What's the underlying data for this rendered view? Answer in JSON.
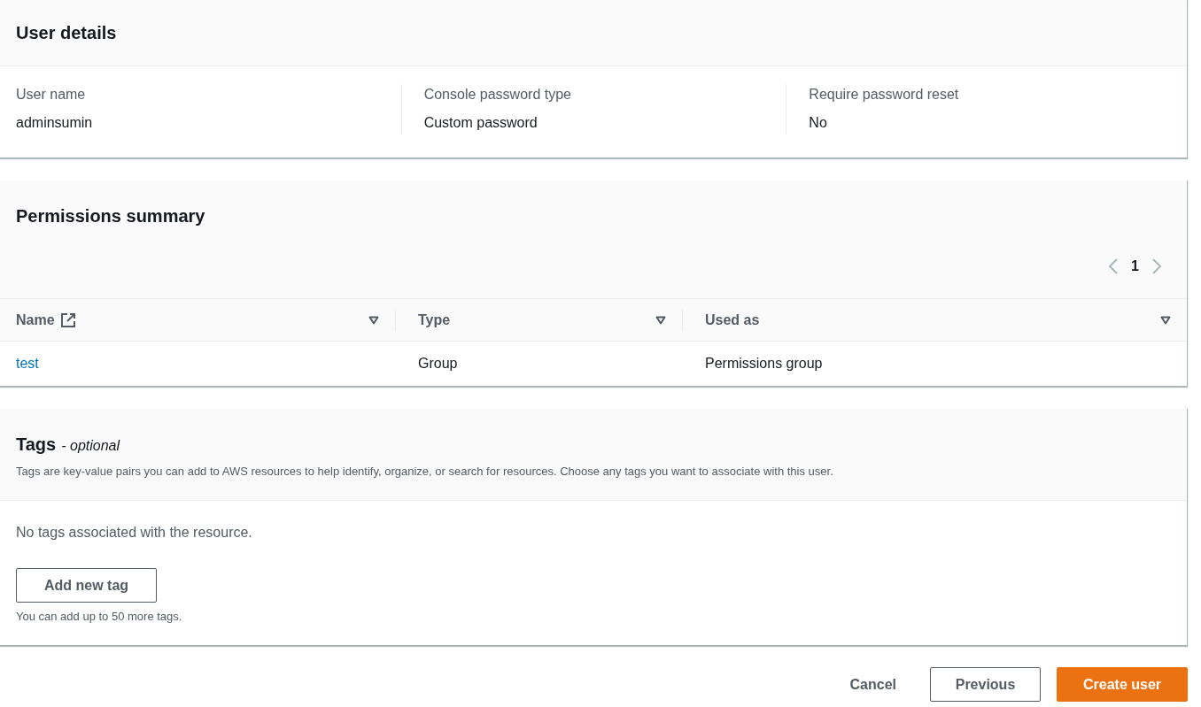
{
  "user_details": {
    "title": "User details",
    "fields": [
      {
        "label": "User name",
        "value": "adminsumin"
      },
      {
        "label": "Console password type",
        "value": "Custom password"
      },
      {
        "label": "Require password reset",
        "value": "No"
      }
    ]
  },
  "permissions_summary": {
    "title": "Permissions summary",
    "pagination": {
      "page": "1"
    },
    "columns": [
      {
        "label": "Name",
        "kind": "external_link"
      },
      {
        "label": "Type",
        "kind": "plain"
      },
      {
        "label": "Used as",
        "kind": "plain"
      }
    ],
    "rows": [
      {
        "cells": [
          "test",
          "Group",
          "Permissions group"
        ]
      }
    ]
  },
  "tags": {
    "title": "Tags",
    "optional_label": "- optional",
    "description": "Tags are key-value pairs you can add to AWS resources to help identify, organize, or search for resources. Choose any tags you want to associate with this user.",
    "empty_message": "No tags associated with the resource.",
    "add_button": "Add new tag",
    "limit_hint": "You can add up to 50 more tags."
  },
  "actions": [
    {
      "label": "Cancel",
      "kind": "link"
    },
    {
      "label": "Previous",
      "kind": "secondary"
    },
    {
      "label": "Create user",
      "kind": "primary"
    }
  ]
}
